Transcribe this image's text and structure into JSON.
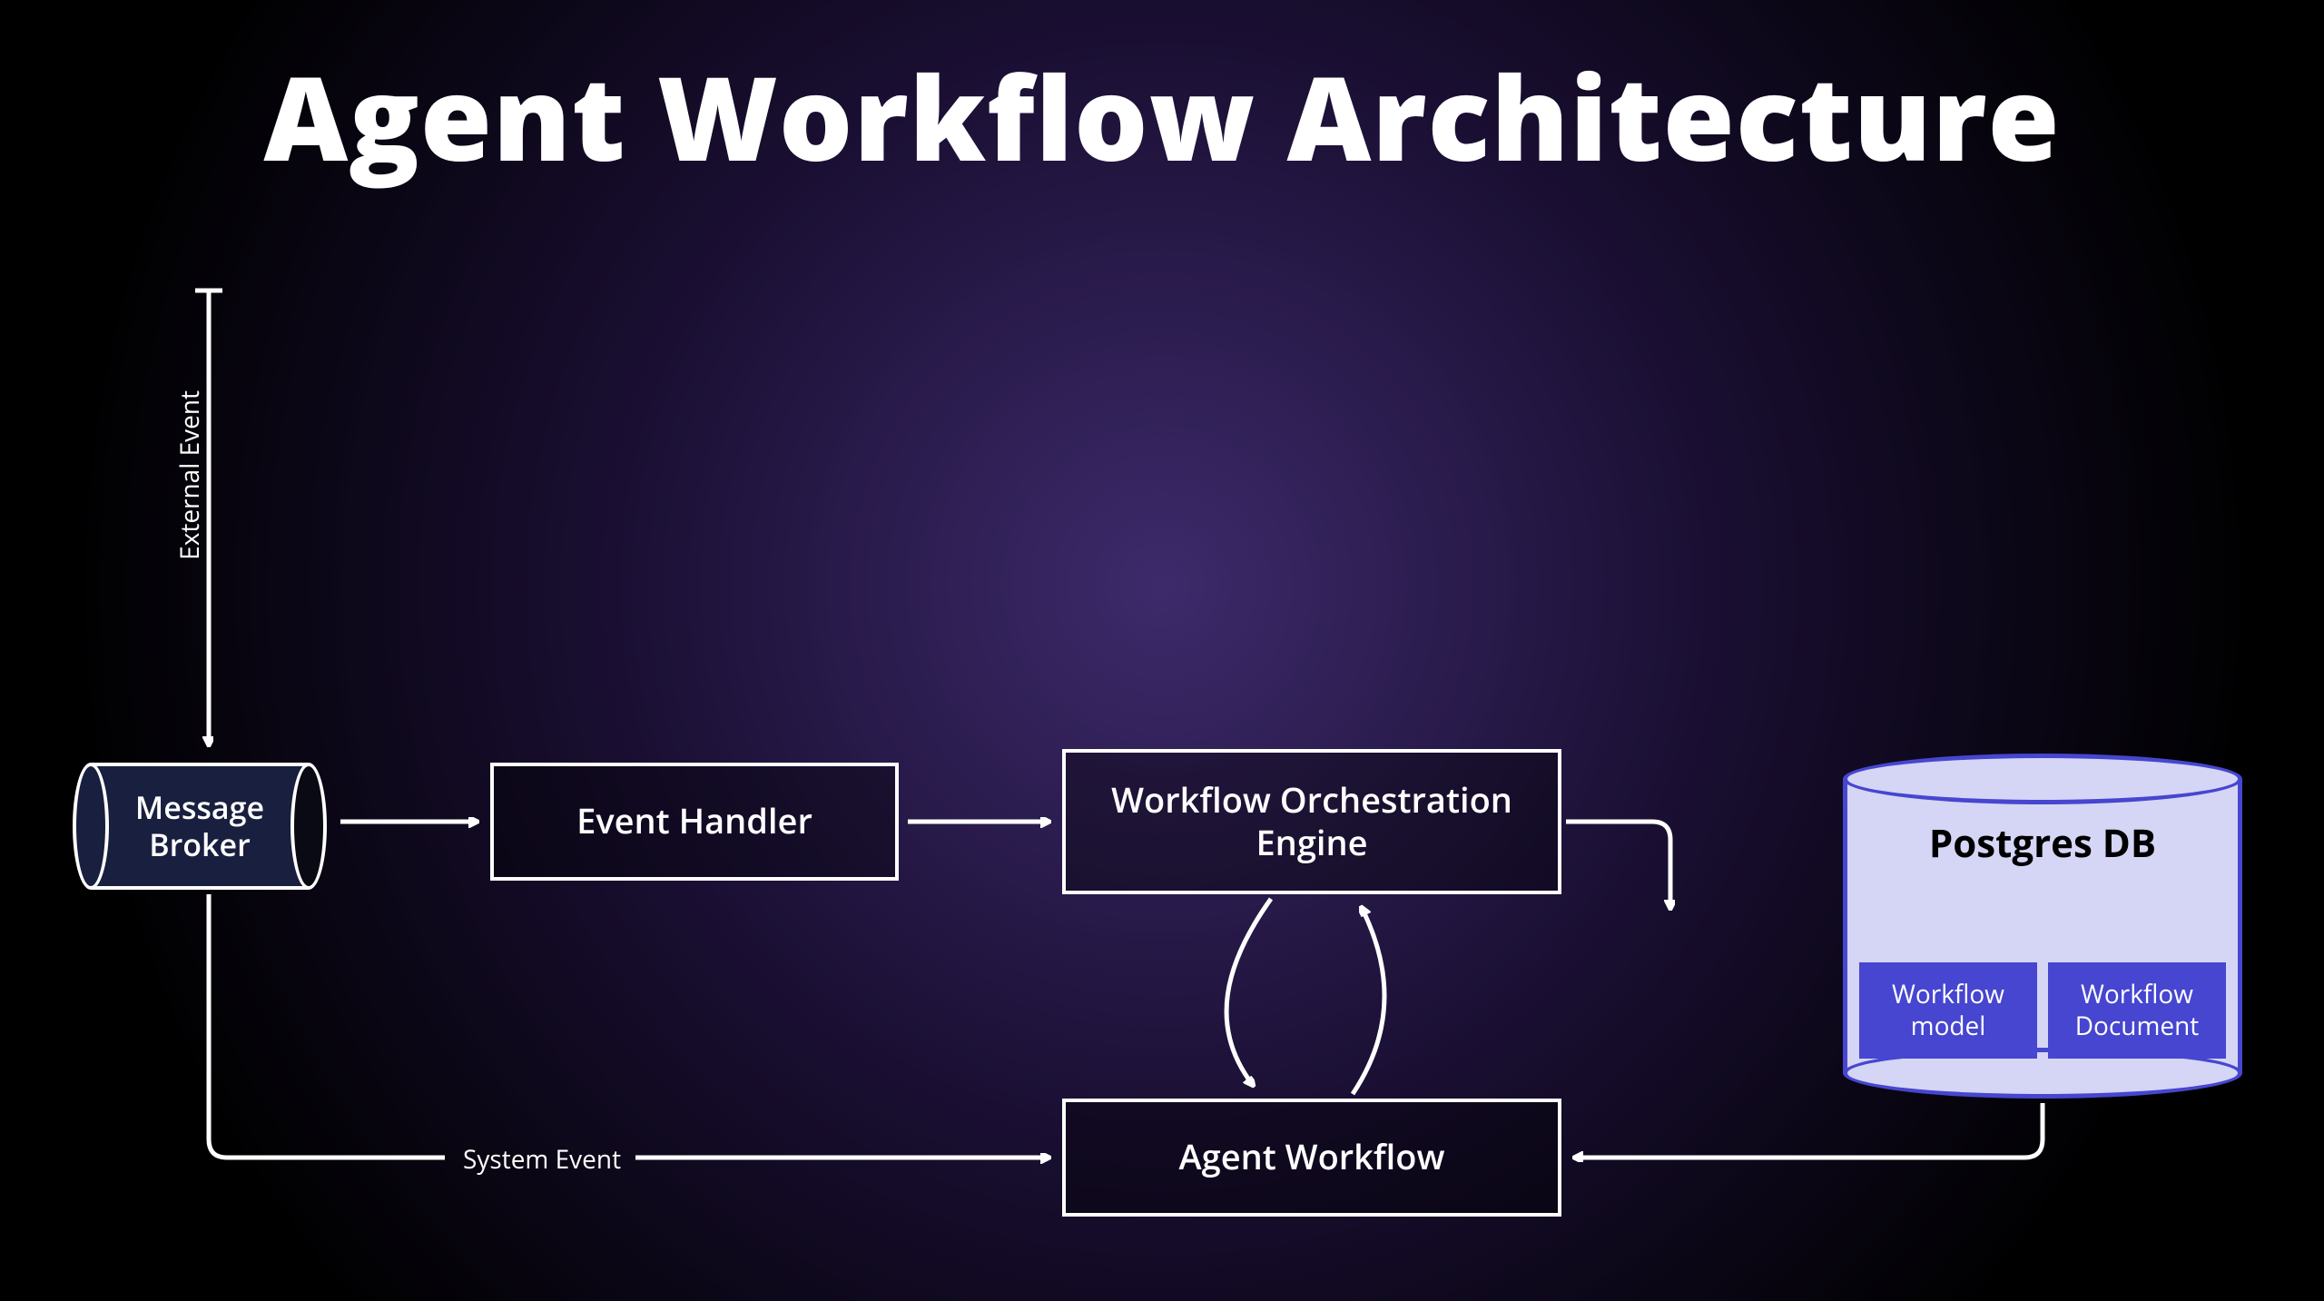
{
  "title": "Agent Workflow Architecture",
  "labels": {
    "external_event": "External Event",
    "system_event": "System Event"
  },
  "nodes": {
    "message_broker": "Message\nBroker",
    "event_handler": "Event Handler",
    "orchestration": "Workflow Orchestration\nEngine",
    "agent_workflow": "Agent Workflow",
    "postgres": "Postgres DB",
    "tables": {
      "workflow_model": "Workflow\nmodel",
      "workflow_document": "Workflow\nDocument"
    }
  },
  "edges": [
    {
      "from": "external_event",
      "to": "message_broker"
    },
    {
      "from": "message_broker",
      "to": "event_handler"
    },
    {
      "from": "event_handler",
      "to": "orchestration"
    },
    {
      "from": "orchestration",
      "to": "postgres"
    },
    {
      "from": "orchestration",
      "to": "agent_workflow",
      "bidirectional": true
    },
    {
      "from": "message_broker",
      "to": "agent_workflow",
      "label": "System Event"
    },
    {
      "from": "postgres",
      "to": "agent_workflow"
    }
  ]
}
